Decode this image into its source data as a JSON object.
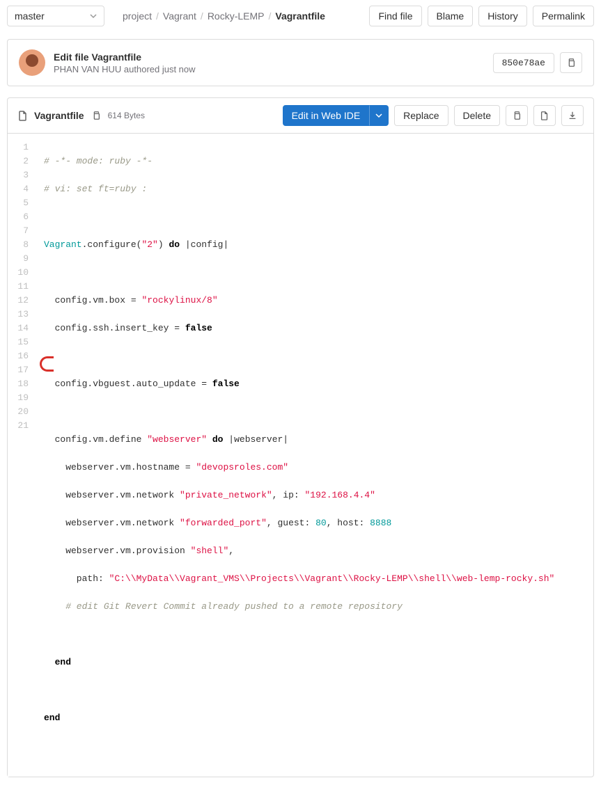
{
  "branch": "master",
  "breadcrumbs": [
    "project",
    "Vagrant",
    "Rocky-LEMP"
  ],
  "breadcrumb_current": "Vagrantfile",
  "actions": {
    "find_file": "Find file",
    "blame": "Blame",
    "history": "History",
    "permalink": "Permalink"
  },
  "commit": {
    "title": "Edit file Vagrantfile",
    "author": "PHAN VAN HUU",
    "authored": "authored just now",
    "sha": "850e78ae"
  },
  "file": {
    "name": "Vagrantfile",
    "size": "614 Bytes",
    "edit_ide": "Edit in Web IDE",
    "replace": "Replace",
    "delete": "Delete"
  },
  "code": {
    "l1": "# -*- mode: ruby -*-",
    "l2": "# vi: set ft=ruby :",
    "l3": "",
    "l4a": "Vagrant",
    "l4b": ".configure(",
    "l4c": "\"2\"",
    "l4d": ") ",
    "l4e": "do",
    "l4f": " |config|",
    "l5": "",
    "l6a": "  config.vm.box = ",
    "l6b": "\"rockylinux/8\"",
    "l7a": "  config.ssh.insert_key = ",
    "l7b": "false",
    "l8": "",
    "l9a": "  config.vbguest.auto_update = ",
    "l9b": "false",
    "l10": "",
    "l11a": "  config.vm.define ",
    "l11b": "\"webserver\"",
    "l11c": " ",
    "l11d": "do",
    "l11e": " |webserver|",
    "l12a": "    webserver.vm.hostname = ",
    "l12b": "\"devopsroles.com\"",
    "l13a": "    webserver.vm.network ",
    "l13b": "\"private_network\"",
    "l13c": ", ip: ",
    "l13d": "\"192.168.4.4\"",
    "l14a": "    webserver.vm.network ",
    "l14b": "\"forwarded_port\"",
    "l14c": ", guest: ",
    "l14d": "80",
    "l14e": ", host: ",
    "l14f": "8888",
    "l15a": "    webserver.vm.provision ",
    "l15b": "\"shell\"",
    "l15c": ",",
    "l16a": "      path: ",
    "l16b": "\"C:\\\\MyData\\\\Vagrant_VMS\\\\Projects\\\\Vagrant\\\\Rocky-LEMP\\\\shell\\\\web-lemp-rocky.sh\"",
    "l17": "    # edit Git Revert Commit already pushed to a remote repository",
    "l18": "",
    "l19a": "  ",
    "l19b": "end",
    "l20": "",
    "l21a": "",
    "l21b": "end"
  },
  "lines": [
    "1",
    "2",
    "3",
    "4",
    "5",
    "6",
    "7",
    "8",
    "9",
    "10",
    "11",
    "12",
    "13",
    "14",
    "15",
    "16",
    "17",
    "18",
    "19",
    "20",
    "21"
  ]
}
